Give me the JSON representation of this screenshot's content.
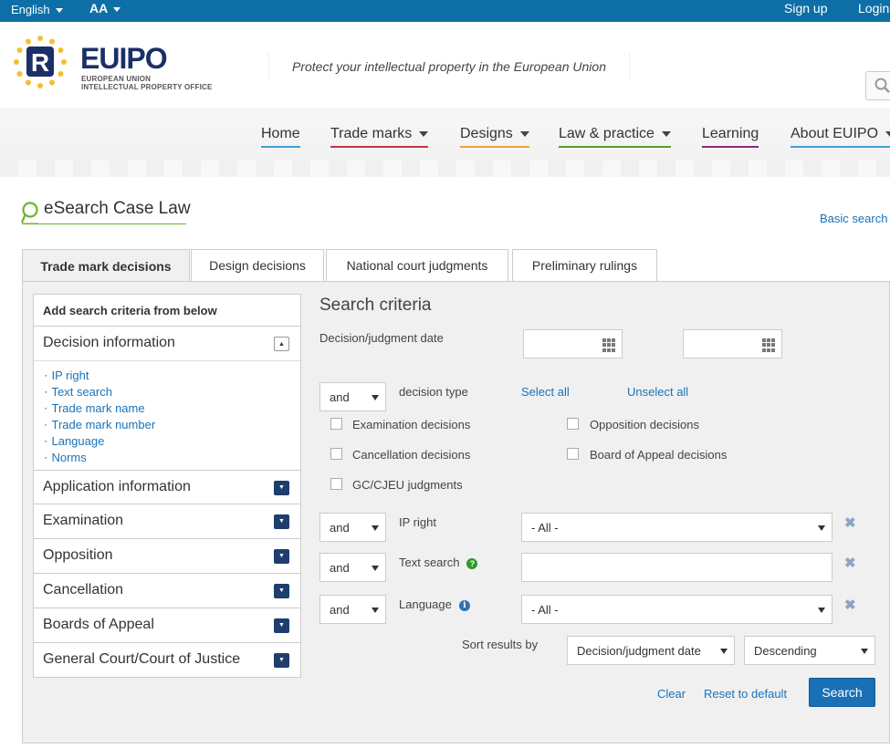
{
  "topbar": {
    "language": "English",
    "text_size": "AA",
    "signup": "Sign up",
    "login": "Login"
  },
  "brand": {
    "name_eu": "EU",
    "name_ipo": "IPO",
    "sub_line1": "EUROPEAN UNION",
    "sub_line2": "INTELLECTUAL PROPERTY OFFICE",
    "tagline": "Protect your intellectual property in the European Union",
    "logo_letter": "R",
    "colors": {
      "brand_blue": "#1b2f68",
      "star_yellow": "#f2c12e",
      "topbar_blue": "#0d6fa6"
    }
  },
  "nav": {
    "items": [
      {
        "label": "Home",
        "underline": "#3f9fd8"
      },
      {
        "label": "Trade marks",
        "underline": "#c8343c"
      },
      {
        "label": "Designs",
        "underline": "#e8a43a"
      },
      {
        "label": "Law & practice",
        "underline": "#5a9a2a"
      },
      {
        "label": "Learning",
        "underline": "#8a2a7a"
      },
      {
        "label": "About EUIPO",
        "underline": "#3f9fd8"
      }
    ]
  },
  "page": {
    "title": "eSearch Case Law",
    "basic_search": "Basic search"
  },
  "tabs": [
    "Trade mark decisions",
    "Design decisions",
    "National court judgments",
    "Preliminary rulings"
  ],
  "sidebar": {
    "heading": "Add search criteria from below",
    "decision_section": "Decision information",
    "decision_items": [
      "IP right",
      "Text search",
      "Trade mark name",
      "Trade mark number",
      "Language",
      "Norms"
    ],
    "sections": [
      "Application information",
      "Examination",
      "Opposition",
      "Cancellation",
      "Boards of Appeal",
      "General Court/Court of Justice"
    ]
  },
  "criteria": {
    "title": "Search criteria",
    "date_label": "Decision/judgment date",
    "operator": "and",
    "decision_type_label": "decision type",
    "select_all": "Select all",
    "unselect_all": "Unselect all",
    "checkboxes": [
      "Examination decisions",
      "Opposition decisions",
      "Cancellation decisions",
      "Board of Appeal decisions",
      "GC/CJEU judgments"
    ],
    "ip_right_label": "IP right",
    "ip_right_value": "- All -",
    "text_search_label": "Text search",
    "language_label": "Language",
    "language_value": "- All -",
    "sort_label": "Sort results by",
    "sort_field": "Decision/judgment date",
    "sort_order": "Descending",
    "clear": "Clear",
    "reset": "Reset to default",
    "search": "Search"
  }
}
